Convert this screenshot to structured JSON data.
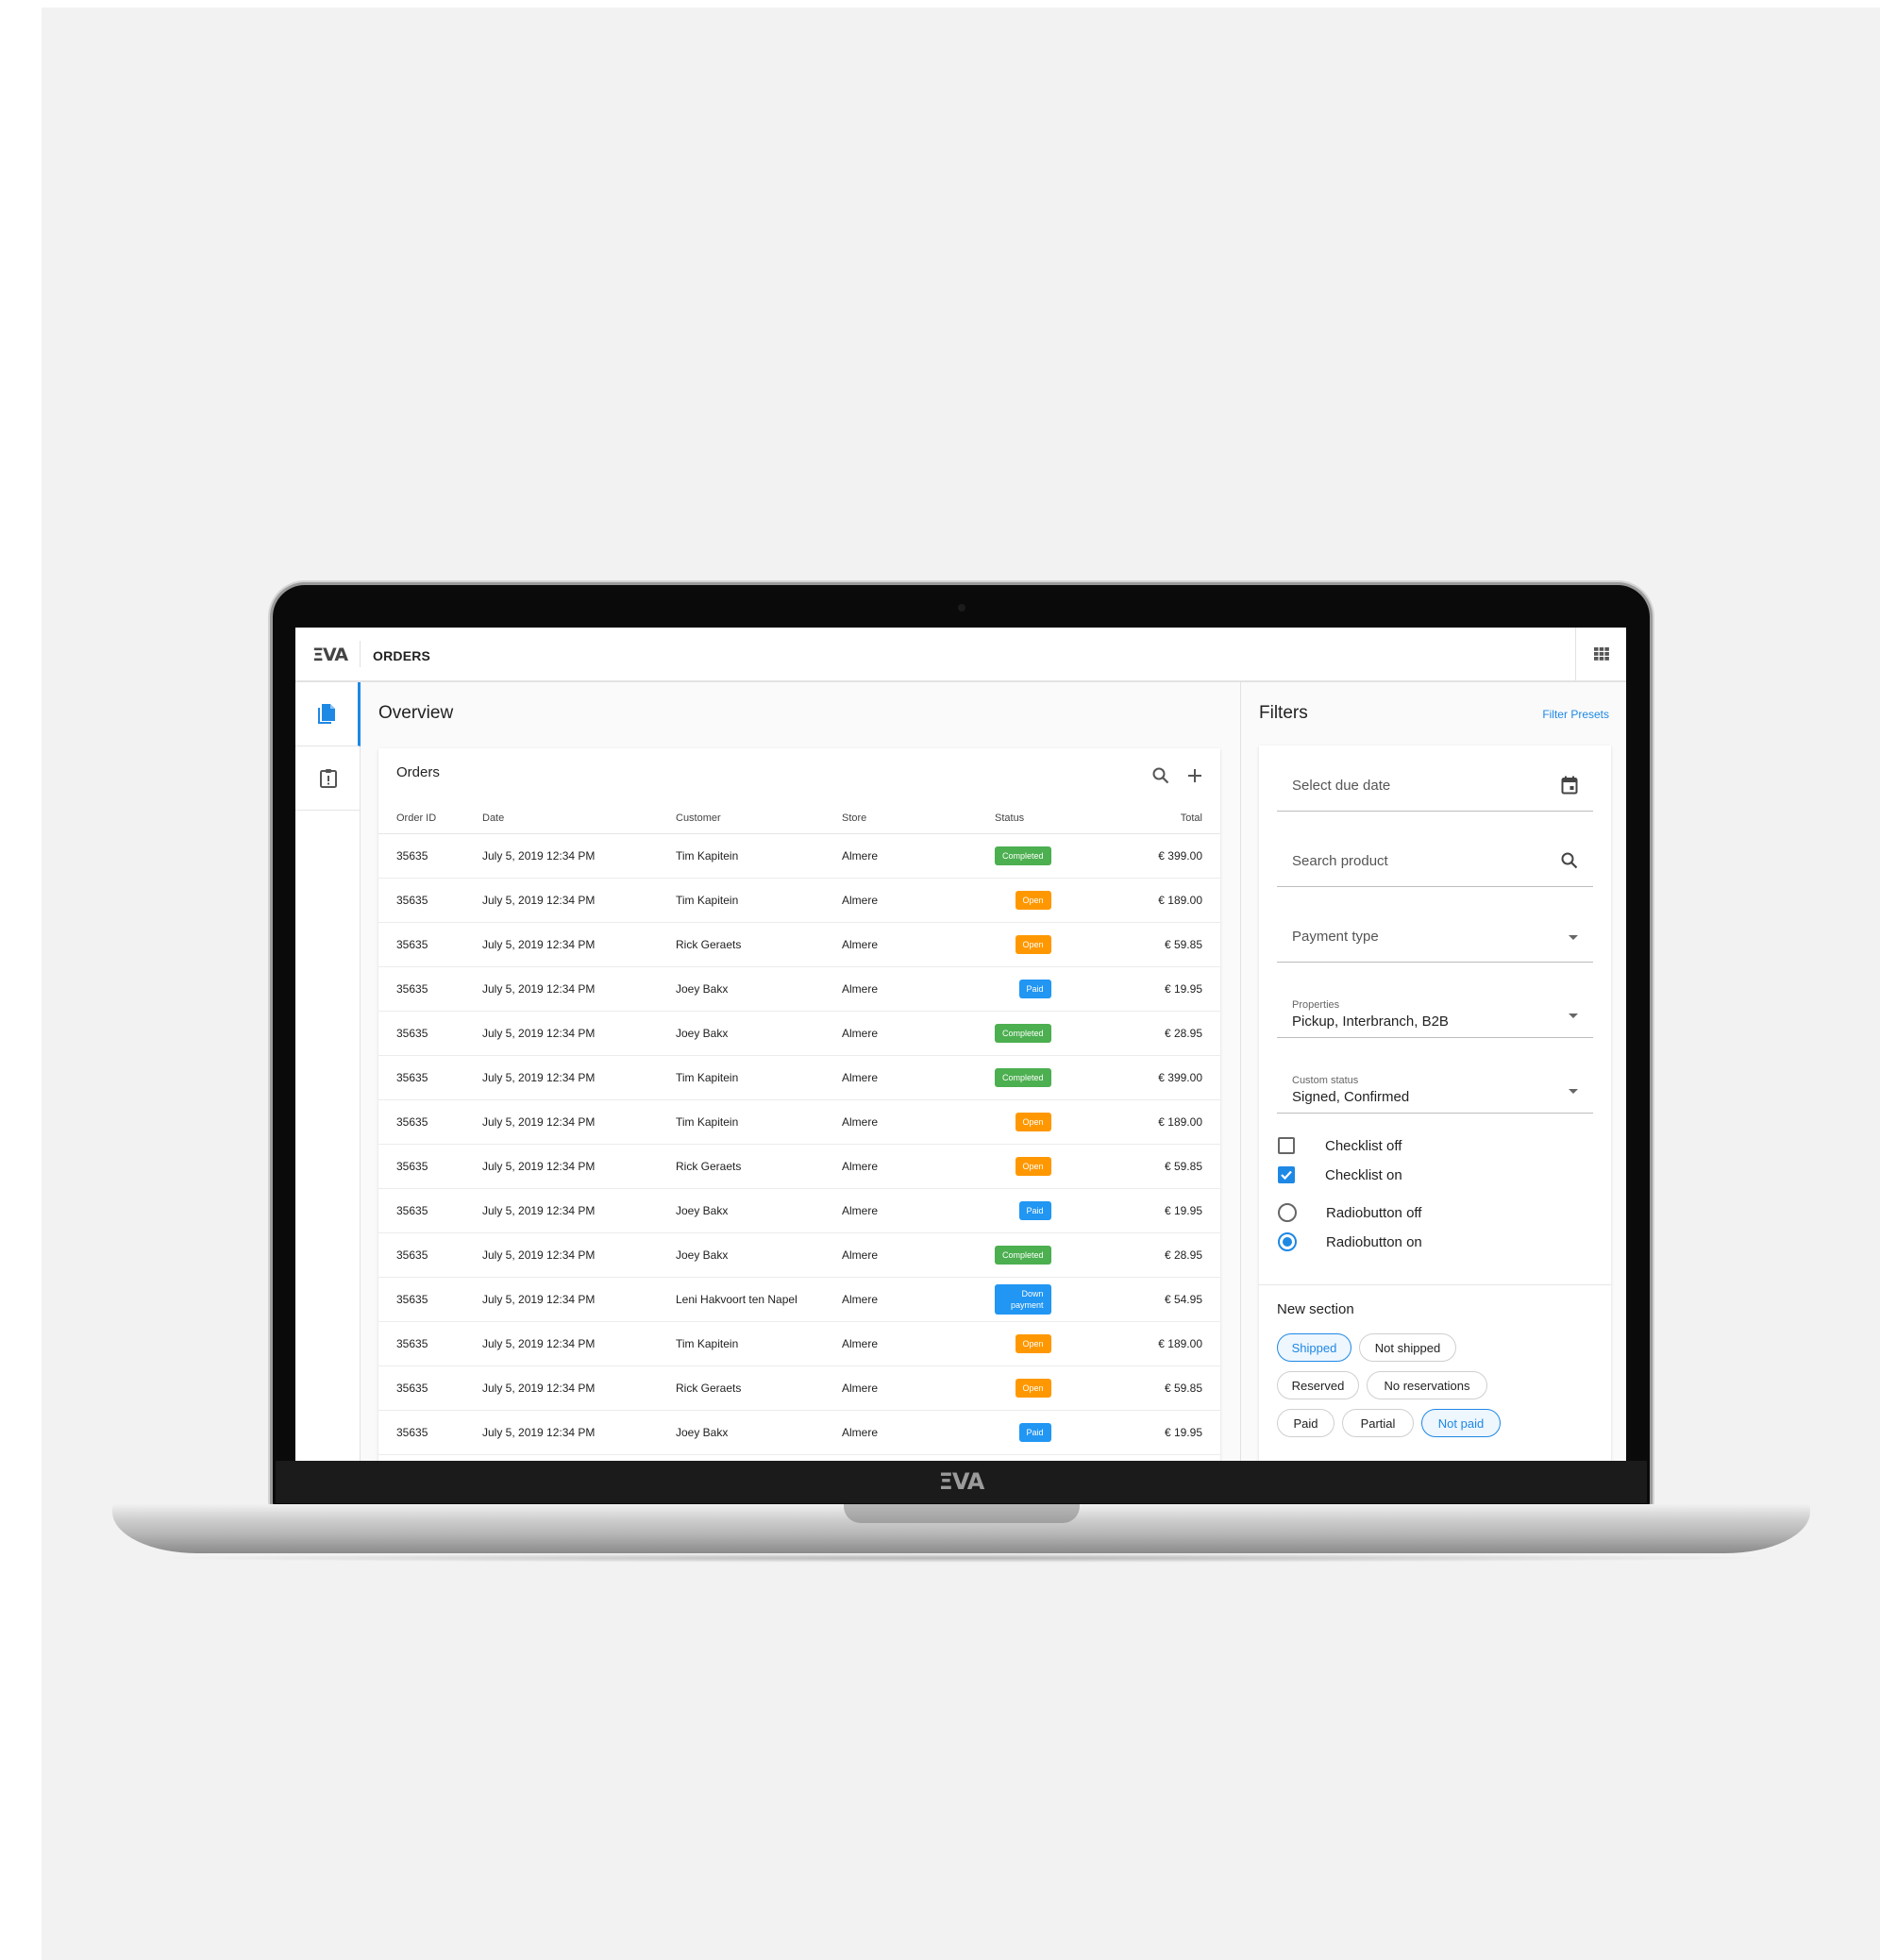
{
  "brand": {
    "logo": "ΞVA",
    "chin_logo": "ΞVA"
  },
  "topbar": {
    "title": "ORDERS",
    "apps_icon": "grid-icon"
  },
  "sidebar": {
    "items": [
      {
        "icon": "documents-icon",
        "active": true
      },
      {
        "icon": "clipboard-alert-icon",
        "active": false
      }
    ]
  },
  "overview": {
    "title": "Overview"
  },
  "orders_card": {
    "title": "Orders",
    "columns": [
      "Order ID",
      "Date",
      "Customer",
      "Store",
      "Status",
      "Total"
    ],
    "status_colors": {
      "Completed": "#4caf50",
      "Open": "#ff9800",
      "Paid": "#2196f3",
      "Down payment": "#2196f3"
    },
    "rows": [
      {
        "id": "35635",
        "date": "July 5, 2019 12:34 PM",
        "customer": "Tim Kapitein",
        "store": "Almere",
        "status": "Completed",
        "total": "€ 399.00"
      },
      {
        "id": "35635",
        "date": "July 5, 2019 12:34 PM",
        "customer": "Tim Kapitein",
        "store": "Almere",
        "status": "Open",
        "total": "€ 189.00"
      },
      {
        "id": "35635",
        "date": "July 5, 2019 12:34 PM",
        "customer": "Rick Geraets",
        "store": "Almere",
        "status": "Open",
        "total": "€ 59.85"
      },
      {
        "id": "35635",
        "date": "July 5, 2019 12:34 PM",
        "customer": "Joey Bakx",
        "store": "Almere",
        "status": "Paid",
        "total": "€ 19.95"
      },
      {
        "id": "35635",
        "date": "July 5, 2019 12:34 PM",
        "customer": "Joey Bakx",
        "store": "Almere",
        "status": "Completed",
        "total": "€ 28.95"
      },
      {
        "id": "35635",
        "date": "July 5, 2019 12:34 PM",
        "customer": "Tim Kapitein",
        "store": "Almere",
        "status": "Completed",
        "total": "€ 399.00"
      },
      {
        "id": "35635",
        "date": "July 5, 2019 12:34 PM",
        "customer": "Tim Kapitein",
        "store": "Almere",
        "status": "Open",
        "total": "€ 189.00"
      },
      {
        "id": "35635",
        "date": "July 5, 2019 12:34 PM",
        "customer": "Rick Geraets",
        "store": "Almere",
        "status": "Open",
        "total": "€ 59.85"
      },
      {
        "id": "35635",
        "date": "July 5, 2019 12:34 PM",
        "customer": "Joey Bakx",
        "store": "Almere",
        "status": "Paid",
        "total": "€ 19.95"
      },
      {
        "id": "35635",
        "date": "July 5, 2019 12:34 PM",
        "customer": "Joey Bakx",
        "store": "Almere",
        "status": "Completed",
        "total": "€ 28.95"
      },
      {
        "id": "35635",
        "date": "July 5, 2019 12:34 PM",
        "customer": "Leni Hakvoort ten Napel",
        "store": "Almere",
        "status": "Down payment",
        "total": "€ 54.95"
      },
      {
        "id": "35635",
        "date": "July 5, 2019 12:34 PM",
        "customer": "Tim Kapitein",
        "store": "Almere",
        "status": "Open",
        "total": "€ 189.00"
      },
      {
        "id": "35635",
        "date": "July 5, 2019 12:34 PM",
        "customer": "Rick Geraets",
        "store": "Almere",
        "status": "Open",
        "total": "€ 59.85"
      },
      {
        "id": "35635",
        "date": "July 5, 2019 12:34 PM",
        "customer": "Joey Bakx",
        "store": "Almere",
        "status": "Paid",
        "total": "€ 19.95"
      }
    ]
  },
  "filters": {
    "title": "Filters",
    "presets_link": "Filter Presets",
    "due_date": {
      "placeholder": "Select due date",
      "icon": "calendar-icon"
    },
    "search_product": {
      "placeholder": "Search product",
      "icon": "search-icon"
    },
    "payment_type": {
      "placeholder": "Payment type",
      "icon": "caret-down-icon"
    },
    "properties": {
      "label": "Properties",
      "value": "Pickup, Interbranch, B2B"
    },
    "custom_status": {
      "label": "Custom status",
      "value": "Signed, Confirmed"
    },
    "checklist_off": "Checklist off",
    "checklist_on": "Checklist on",
    "radio_off": "Radiobutton off",
    "radio_on": "Radiobutton on",
    "new_section": "New section",
    "chips": [
      {
        "label": "Shipped",
        "selected": true
      },
      {
        "label": "Not shipped",
        "selected": false
      },
      {
        "label": "Reserved",
        "selected": false
      },
      {
        "label": "No reservations",
        "selected": false
      },
      {
        "label": "Paid",
        "selected": false
      },
      {
        "label": "Partial",
        "selected": false
      },
      {
        "label": "Not paid",
        "selected": true
      }
    ]
  },
  "colors": {
    "accent": "#1e88e5",
    "background": "#f2f2f2"
  }
}
